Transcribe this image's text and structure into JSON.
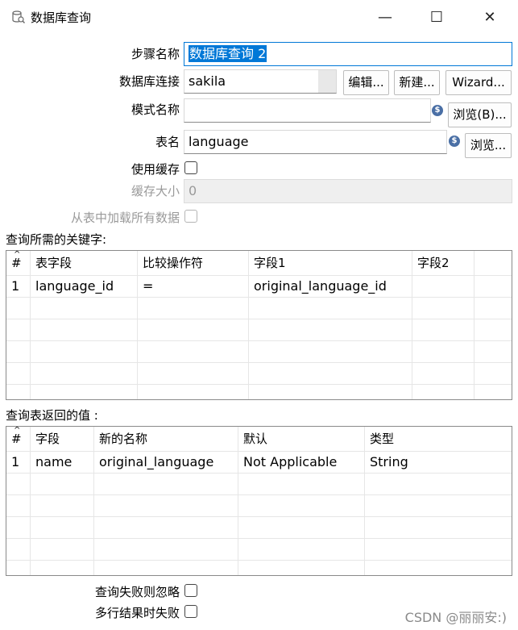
{
  "window": {
    "title": "数据库查询",
    "icon": "database-query-icon",
    "controls": {
      "minimize": "—",
      "maximize": "☐",
      "close": "✕"
    }
  },
  "form": {
    "step_name_label": "步骤名称",
    "step_name_value": "数据库查询 2",
    "connection_label": "数据库连接",
    "connection_value": "sakila",
    "edit_button": "编辑...",
    "new_button": "新建...",
    "wizard_button": "Wizard...",
    "schema_label": "模式名称",
    "schema_value": "",
    "schema_browse_button": "浏览(B)...",
    "table_label": "表名",
    "table_value": "language",
    "table_browse_button": "浏览...",
    "use_cache_label": "使用缓存",
    "cache_size_label": "缓存大小",
    "cache_size_value": "0",
    "load_all_label": "从表中加载所有数据"
  },
  "keys_section": {
    "title": "查询所需的关键字:",
    "columns": [
      "#",
      "表字段",
      "比较操作符",
      "字段1",
      "字段2"
    ],
    "rows": [
      [
        "1",
        "language_id",
        "=",
        "original_language_id",
        ""
      ]
    ]
  },
  "values_section": {
    "title": "查询表返回的值 :",
    "columns": [
      "#",
      "字段",
      "新的名称",
      "默认",
      "类型"
    ],
    "rows": [
      [
        "1",
        "name",
        "original_language",
        "Not Applicable",
        "String"
      ]
    ]
  },
  "options": {
    "ignore_failure_label": "查询失败则忽略",
    "fail_multi_label": "多行结果时失败"
  },
  "watermark": "CSDN @丽丽安:)",
  "colors": {
    "selection": "#0078d7",
    "accent_icon": "#4a6fa5"
  }
}
